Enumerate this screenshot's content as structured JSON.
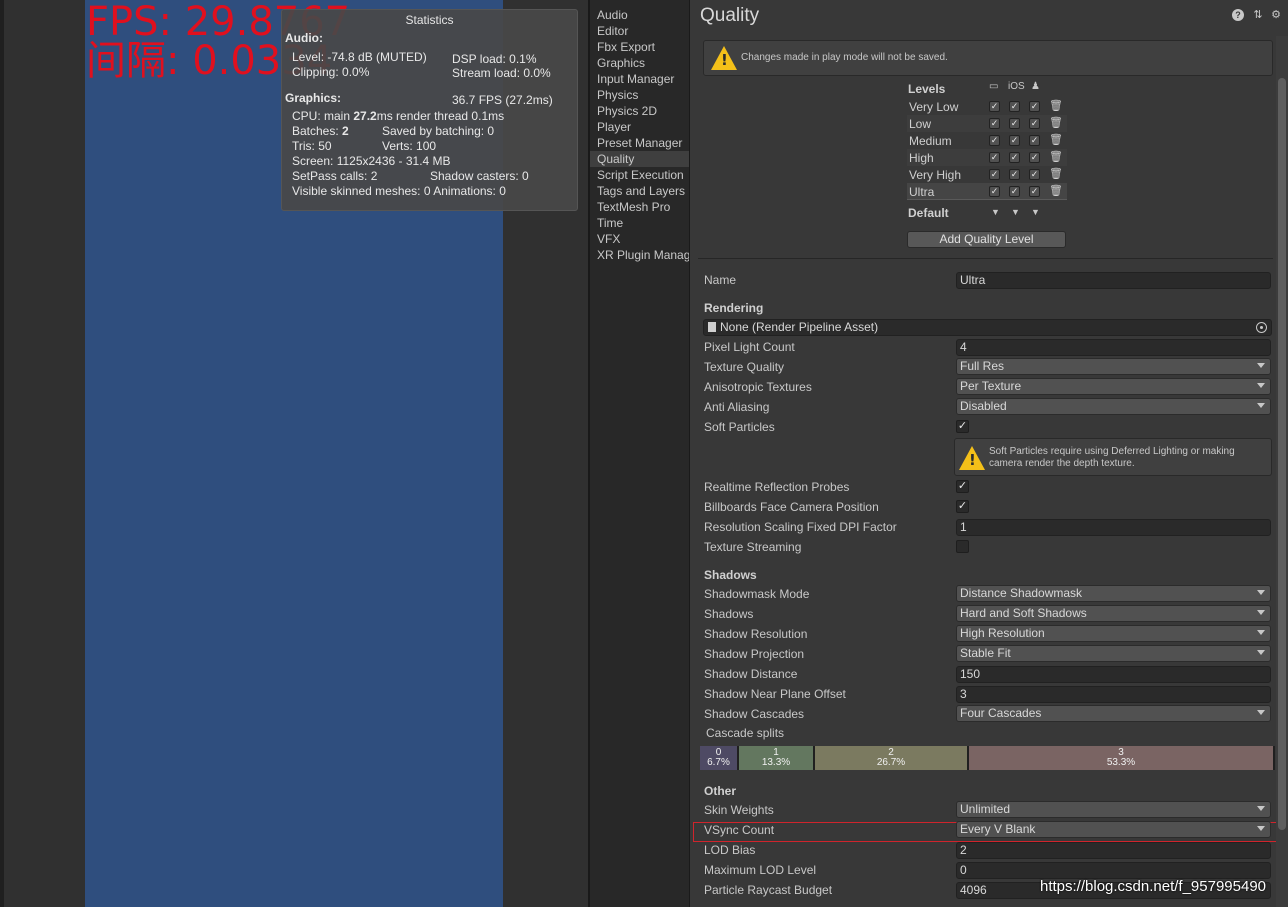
{
  "game": {
    "fps_text": "FPS: 29.8767",
    "interval_text": "间隔: 0.0334"
  },
  "stats": {
    "title": "Statistics",
    "audio_header": "Audio:",
    "level": "Level: -74.8 dB (MUTED)",
    "dsp_load": "DSP load: 0.1%",
    "clipping": "Clipping: 0.0%",
    "stream_load": "Stream load: 0.0%",
    "graphics_header": "Graphics:",
    "fps_ms": "36.7 FPS (27.2ms)",
    "cpu_prefix": "CPU: main ",
    "cpu_main": "27.2",
    "cpu_suffix": "ms  render thread 0.1ms",
    "batches_prefix": "Batches: ",
    "batches": "2",
    "saved_by_batching": "Saved by batching: 0",
    "tris": "Tris: 50",
    "verts": "Verts: 100",
    "screen": "Screen: 1125x2436 - 31.4 MB",
    "setpass": "SetPass calls: 2",
    "shadow_casters": "Shadow casters: 0",
    "skinned": "Visible skinned meshes: 0  Animations: 0"
  },
  "sidebar": {
    "items": [
      {
        "label": "Audio"
      },
      {
        "label": "Editor"
      },
      {
        "label": "Fbx Export"
      },
      {
        "label": "Graphics"
      },
      {
        "label": "Input Manager"
      },
      {
        "label": "Physics"
      },
      {
        "label": "Physics 2D"
      },
      {
        "label": "Player"
      },
      {
        "label": "Preset Manager"
      },
      {
        "label": "Quality"
      },
      {
        "label": "Script Execution"
      },
      {
        "label": "Tags and Layers"
      },
      {
        "label": "TextMesh Pro"
      },
      {
        "label": "Time"
      },
      {
        "label": "VFX"
      },
      {
        "label": "XR Plugin Manag"
      }
    ],
    "active": "Quality"
  },
  "inspector": {
    "title": "Quality",
    "playmode_warning": "Changes made in play mode will not be saved.",
    "levels_label": "Levels",
    "platforms": [
      "standalone-icon",
      "iOS",
      "android-icon"
    ],
    "ios_label": "iOS",
    "levels": [
      {
        "name": "Very Low"
      },
      {
        "name": "Low"
      },
      {
        "name": "Medium"
      },
      {
        "name": "High"
      },
      {
        "name": "Very High"
      },
      {
        "name": "Ultra"
      }
    ],
    "selected_level": "Ultra",
    "default_label": "Default",
    "add_level_button": "Add Quality Level",
    "name_label": "Name",
    "name_value": "Ultra",
    "rendering": {
      "header": "Rendering",
      "pipeline_asset": "None (Render Pipeline Asset)",
      "pixel_light_count_label": "Pixel Light Count",
      "pixel_light_count": "4",
      "texture_quality_label": "Texture Quality",
      "texture_quality": "Full Res",
      "anisotropic_label": "Anisotropic Textures",
      "anisotropic": "Per Texture",
      "anti_aliasing_label": "Anti Aliasing",
      "anti_aliasing": "Disabled",
      "soft_particles_label": "Soft Particles",
      "soft_particles_warning": "Soft Particles require using Deferred Lighting or making camera render the depth texture.",
      "realtime_reflection_label": "Realtime Reflection Probes",
      "billboards_label": "Billboards Face Camera Position",
      "resolution_scaling_label": "Resolution Scaling Fixed DPI Factor",
      "resolution_scaling": "1",
      "texture_streaming_label": "Texture Streaming"
    },
    "shadows": {
      "header": "Shadows",
      "shadowmask_mode_label": "Shadowmask Mode",
      "shadowmask_mode": "Distance Shadowmask",
      "shadows_label": "Shadows",
      "shadows": "Hard and Soft Shadows",
      "resolution_label": "Shadow Resolution",
      "resolution": "High Resolution",
      "projection_label": "Shadow Projection",
      "projection": "Stable Fit",
      "distance_label": "Shadow Distance",
      "distance": "150",
      "near_plane_label": "Shadow Near Plane Offset",
      "near_plane": "3",
      "cascades_label": "Shadow Cascades",
      "cascades": "Four Cascades",
      "cascade_splits_label": "Cascade splits",
      "cascade_splits": [
        {
          "index": "0",
          "percent": "6.7%",
          "fraction": 0.067,
          "color": "#4e4a64"
        },
        {
          "index": "1",
          "percent": "13.3%",
          "fraction": 0.133,
          "color": "#63775f"
        },
        {
          "index": "2",
          "percent": "26.7%",
          "fraction": 0.267,
          "color": "#7b7a60"
        },
        {
          "index": "3",
          "percent": "53.3%",
          "fraction": 0.533,
          "color": "#7a6463"
        }
      ]
    },
    "other": {
      "header": "Other",
      "skin_weights_label": "Skin Weights",
      "skin_weights": "Unlimited",
      "vsync_label": "VSync Count",
      "vsync": "Every V Blank",
      "lod_bias_label": "LOD Bias",
      "lod_bias": "2",
      "max_lod_label": "Maximum LOD Level",
      "max_lod": "0",
      "particle_raycast_label": "Particle Raycast Budget",
      "particle_raycast": "4096"
    }
  },
  "watermark": "https://blog.csdn.net/f_957995490",
  "colors": {
    "game_background": "#2f4e7e",
    "fps_text": "#e0101e",
    "highlight": "#d0242c",
    "warning": "#f4c019"
  }
}
